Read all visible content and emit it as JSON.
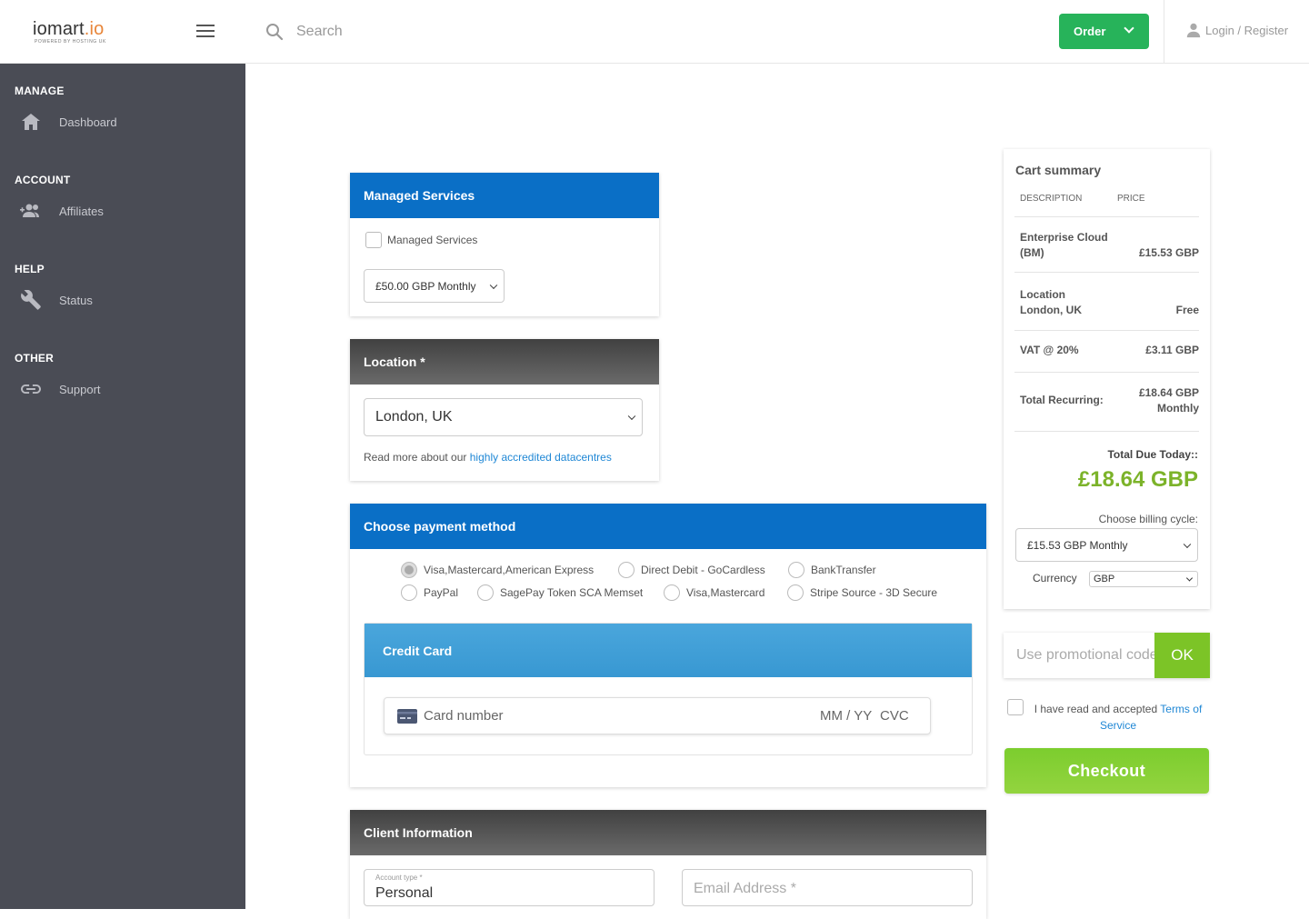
{
  "brand": {
    "name_main": "iomart",
    "name_suffix": ".io",
    "tagline": "POWERED BY HOSTING UK"
  },
  "header": {
    "search_placeholder": "Search",
    "order_label": "Order",
    "login_label": "Login / Register"
  },
  "sidebar": {
    "sections": [
      {
        "heading": "MANAGE",
        "item": "Dashboard",
        "icon": "home-icon"
      },
      {
        "heading": "ACCOUNT",
        "item": "Affiliates",
        "icon": "users-icon"
      },
      {
        "heading": "HELP",
        "item": "Status",
        "icon": "wrench-icon"
      },
      {
        "heading": "OTHER",
        "item": "Support",
        "icon": "link-icon"
      }
    ]
  },
  "managed": {
    "title": "Managed Services",
    "checkbox_label": "Managed Services",
    "select_value": "£50.00 GBP Monthly"
  },
  "location": {
    "title": "Location *",
    "select_value": "London, UK",
    "note_prefix": "Read more about our",
    "note_link": "highly accredited datacentres"
  },
  "payment": {
    "title": "Choose payment method",
    "methods": [
      "Visa,Mastercard,American Express",
      "Direct Debit - GoCardless",
      "BankTransfer",
      "PayPal",
      "SagePay Token SCA Memset",
      "Visa,Mastercard",
      "Stripe Source - 3D Secure"
    ],
    "selected": "Visa,Mastercard,American Express",
    "cc_title": "Credit Card",
    "card_placeholder": "Card number",
    "expiry_placeholder": "MM / YY",
    "cvc_placeholder": "CVC"
  },
  "client": {
    "title": "Client Information",
    "account_type_label": "Account type *",
    "account_type_value": "Personal",
    "email_placeholder": "Email Address *"
  },
  "cart": {
    "title": "Cart summary",
    "col_description": "DESCRIPTION",
    "col_price": "PRICE",
    "product_name_line1": "Enterprise Cloud",
    "product_name_line2": "(BM)",
    "product_price": "£15.53 GBP",
    "location_label": "Location",
    "location_value": "London, UK",
    "location_price": "Free",
    "vat_label": "VAT @ 20%",
    "vat_price": "£3.11 GBP",
    "total_recurring_label": "Total Recurring:",
    "total_recurring_line1": "£18.64 GBP",
    "total_recurring_line2": "Monthly",
    "due_today_label": "Total Due Today::",
    "due_today_value": "£18.64 GBP",
    "billing_cycle_label": "Choose billing cycle:",
    "billing_cycle_value": "£15.53 GBP Monthly",
    "currency_label": "Currency",
    "currency_value": "GBP"
  },
  "promo": {
    "placeholder": "Use promotional code",
    "ok_label": "OK"
  },
  "tos": {
    "prefix": "I have read and accepted",
    "link1": "Terms of",
    "link2": "Service"
  },
  "checkout_label": "Checkout",
  "colors": {
    "sidebar": "#4a4c55",
    "blue_header": "#0a6fc6",
    "green_button": "#27b35a",
    "total_green": "#7cb32a",
    "checkout": "#7ccd2e",
    "credit_card_band": "#3da0d8"
  }
}
